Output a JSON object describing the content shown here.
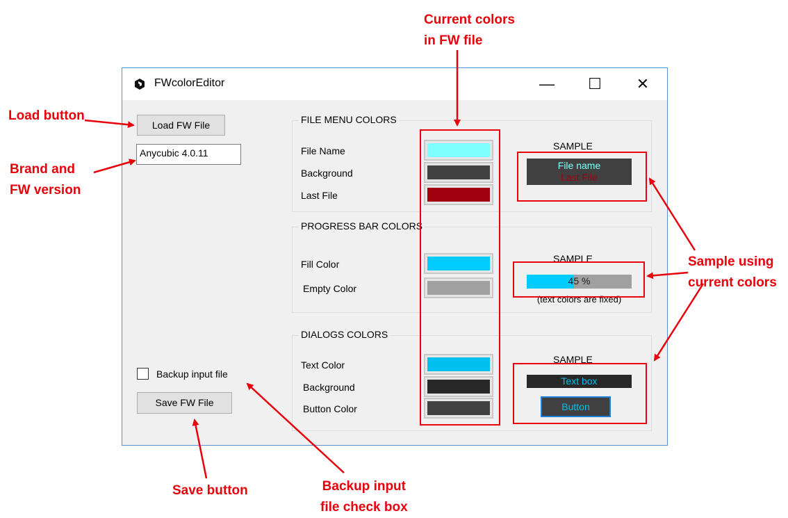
{
  "window": {
    "title": "FWcolorEditor",
    "controls": {
      "minimize": "—",
      "maximize": "☐",
      "close": "✕"
    }
  },
  "left": {
    "load_button": "Load FW File",
    "version_value": "Anycubic 4.0.11",
    "backup_label": "Backup input file",
    "backup_checked": false,
    "save_button": "Save FW File"
  },
  "file_menu": {
    "title": "FILE MENU COLORS",
    "rows": [
      {
        "label": "File Name",
        "color": "#80ffff"
      },
      {
        "label": "Background",
        "color": "#404040"
      },
      {
        "label": "Last File",
        "color": "#a00010"
      }
    ],
    "sample_title": "SAMPLE",
    "sample_file_name": "File name",
    "sample_last_file": "Last File"
  },
  "progress": {
    "title": "PROGRESS BAR COLORS",
    "rows": [
      {
        "label": "Fill Color",
        "color": "#00ccff"
      },
      {
        "label": "Empty Color",
        "color": "#a0a0a0"
      }
    ],
    "sample_title": "SAMPLE",
    "percent": 45,
    "percent_text": "45 %",
    "note": "(text colors are fixed)"
  },
  "dialogs": {
    "title": "DIALOGS COLORS",
    "rows": [
      {
        "label": "Text Color",
        "color": "#00c0f0"
      },
      {
        "label": "Background",
        "color": "#282828"
      },
      {
        "label": "Button Color",
        "color": "#404040"
      }
    ],
    "sample_title": "SAMPLE",
    "sample_textbox": "Text box",
    "sample_button": "Button"
  },
  "annotations": {
    "current_colors": "Current colors\nin FW file",
    "load_button": "Load button",
    "brand_version": "Brand and\nFW version",
    "sample_using": "Sample using\ncurrent colors",
    "save_button": "Save button",
    "backup_checkbox": "Backup input\nfile check box"
  },
  "colors": {
    "annotation_red": "#e8000b",
    "window_border": "#5b8fd6"
  }
}
